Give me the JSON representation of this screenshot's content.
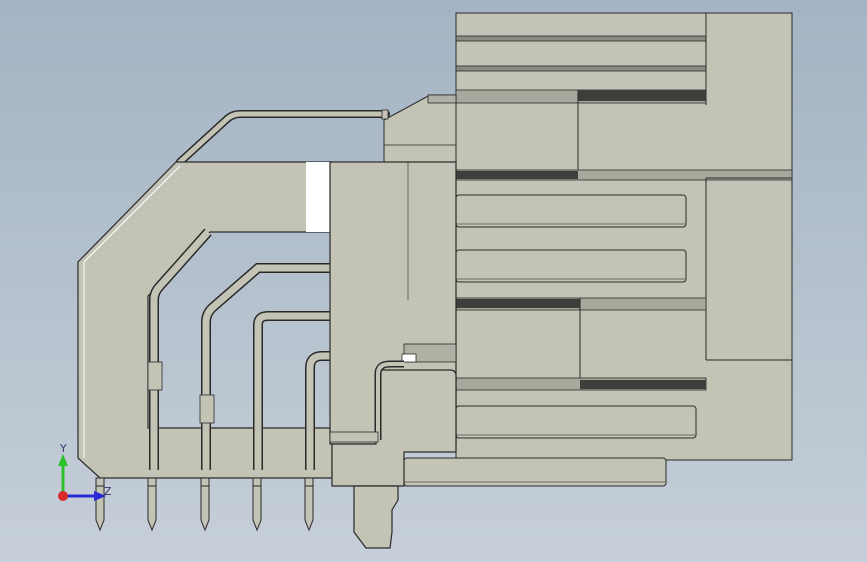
{
  "viewport": {
    "background_top": "#a4b4c4",
    "background_bottom": "#c6cfd9"
  },
  "model": {
    "body_color": "#c4c4b6",
    "edge_color": "#2a2a2a",
    "groove_color": "#3e3e3a",
    "highlight_color": "#ffffff",
    "pin_count": 5
  },
  "triad": {
    "y_label": "Y",
    "z_label": "Z",
    "y_color": "#2cc02c",
    "z_color": "#2a2ad8",
    "x_color": "#d82a2a"
  }
}
